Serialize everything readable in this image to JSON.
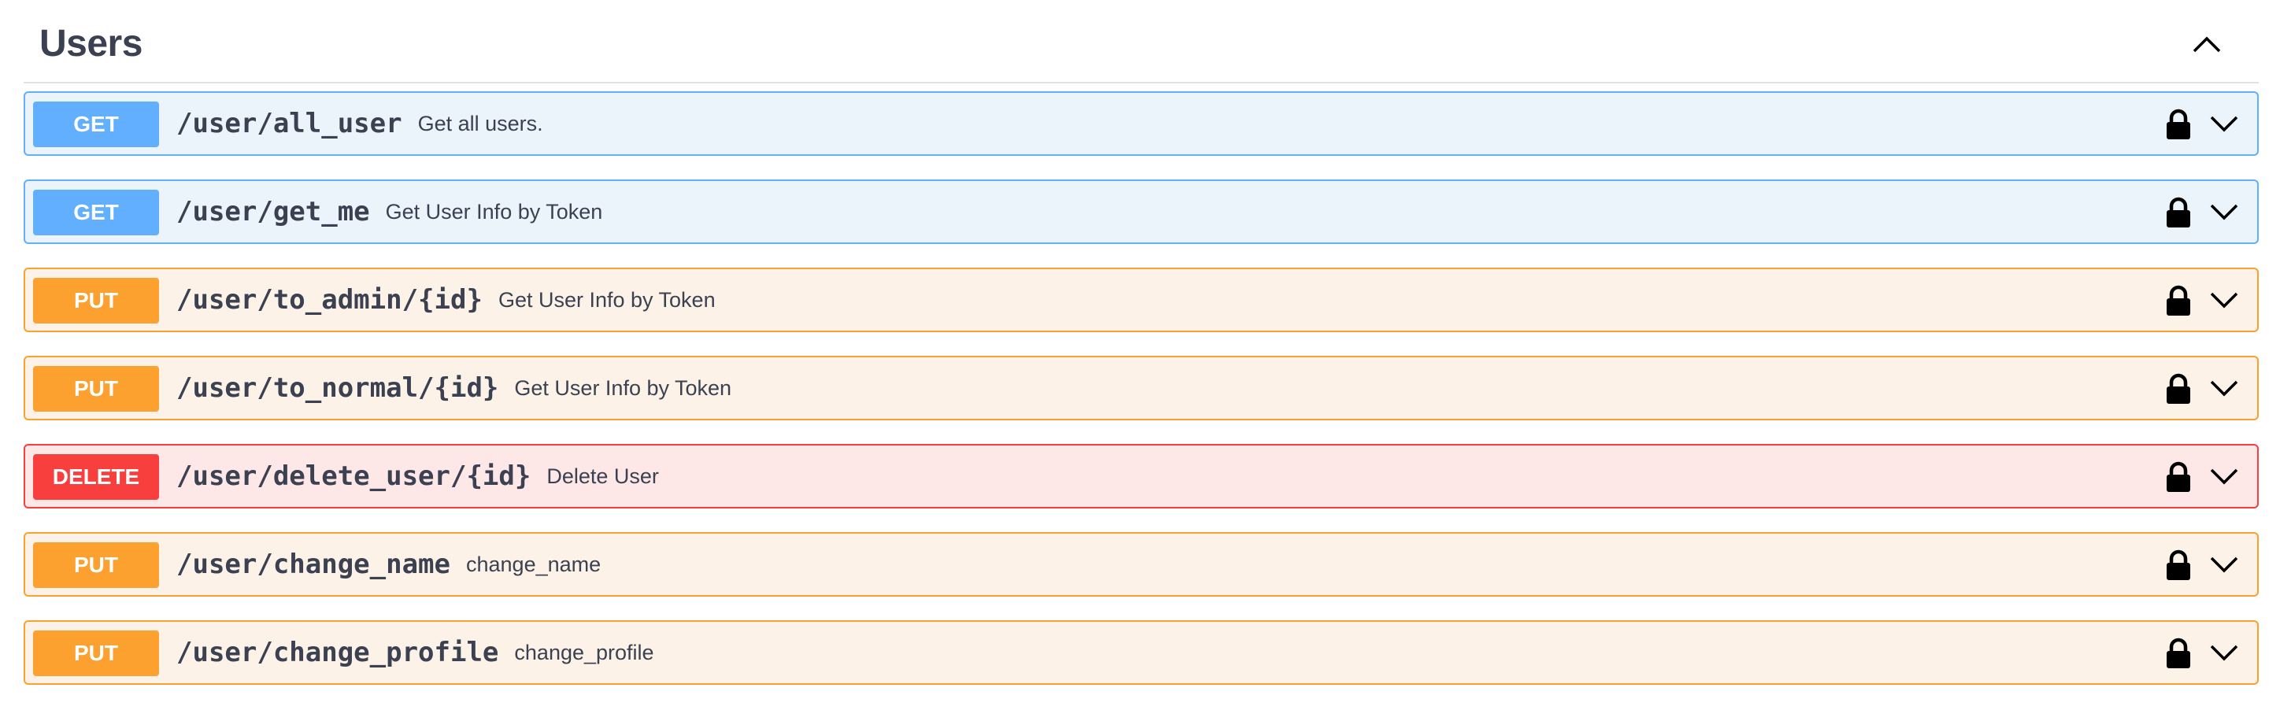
{
  "section": {
    "title": "Users"
  },
  "operations": [
    {
      "method": "GET",
      "path": "/user/all_user",
      "summary": "Get all users."
    },
    {
      "method": "GET",
      "path": "/user/get_me",
      "summary": "Get User Info by Token"
    },
    {
      "method": "PUT",
      "path": "/user/to_admin/{id}",
      "summary": "Get User Info by Token"
    },
    {
      "method": "PUT",
      "path": "/user/to_normal/{id}",
      "summary": "Get User Info by Token"
    },
    {
      "method": "DELETE",
      "path": "/user/delete_user/{id}",
      "summary": "Delete User"
    },
    {
      "method": "PUT",
      "path": "/user/change_name",
      "summary": "change_name"
    },
    {
      "method": "PUT",
      "path": "/user/change_profile",
      "summary": "change_profile"
    }
  ],
  "icons": {
    "section_toggle": "chevron-up-icon",
    "lock": "lock-icon",
    "expand": "chevron-down-icon"
  },
  "colors": {
    "get": {
      "badge": "#61affe",
      "bg": "#ebf3fb",
      "border": "#61affe"
    },
    "put": {
      "badge": "#fca130",
      "bg": "#fcf2e7",
      "border": "#fca130"
    },
    "delete": {
      "badge": "#f93e3e",
      "bg": "#fde7e7",
      "border": "#f93e3e"
    }
  }
}
